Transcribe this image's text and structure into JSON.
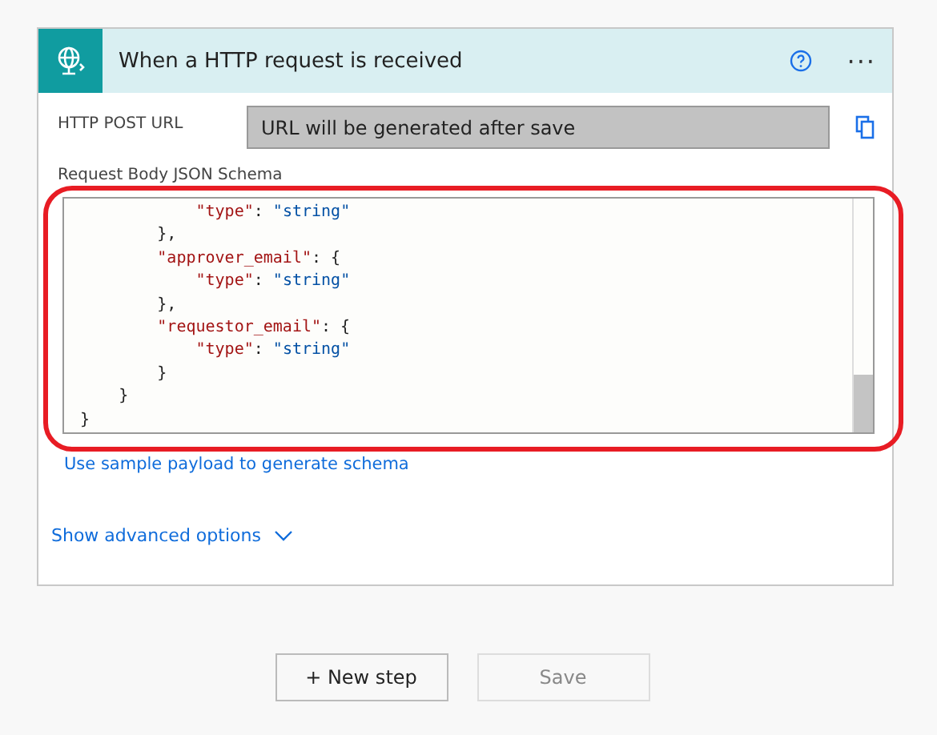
{
  "trigger": {
    "title": "When a HTTP request is received",
    "more": "···",
    "url_label": "HTTP POST URL",
    "url_value": "URL will be generated after save",
    "schema_label": "Request Body JSON Schema",
    "code_lines": [
      [
        {
          "kind": "key",
          "text": "            \"type\""
        },
        {
          "kind": "punct",
          "text": ": "
        },
        {
          "kind": "string",
          "text": "\"string\""
        }
      ],
      [
        {
          "kind": "punct",
          "text": "        },"
        }
      ],
      [
        {
          "kind": "key",
          "text": "        \"approver_email\""
        },
        {
          "kind": "punct",
          "text": ": {"
        }
      ],
      [
        {
          "kind": "key",
          "text": "            \"type\""
        },
        {
          "kind": "punct",
          "text": ": "
        },
        {
          "kind": "string",
          "text": "\"string\""
        }
      ],
      [
        {
          "kind": "punct",
          "text": "        },"
        }
      ],
      [
        {
          "kind": "key",
          "text": "        \"requestor_email\""
        },
        {
          "kind": "punct",
          "text": ": {"
        }
      ],
      [
        {
          "kind": "key",
          "text": "            \"type\""
        },
        {
          "kind": "punct",
          "text": ": "
        },
        {
          "kind": "string",
          "text": "\"string\""
        }
      ],
      [
        {
          "kind": "punct",
          "text": "        }"
        }
      ],
      [
        {
          "kind": "punct",
          "text": "    }"
        }
      ],
      [
        {
          "kind": "punct",
          "text": "}"
        }
      ]
    ],
    "sample_link": "Use sample payload to generate schema",
    "advanced": {
      "label": "Show advanced options",
      "expanded": false
    }
  },
  "buttons": [
    {
      "label": "+ New step",
      "disabled": false
    },
    {
      "label": "Save",
      "disabled": true
    }
  ]
}
